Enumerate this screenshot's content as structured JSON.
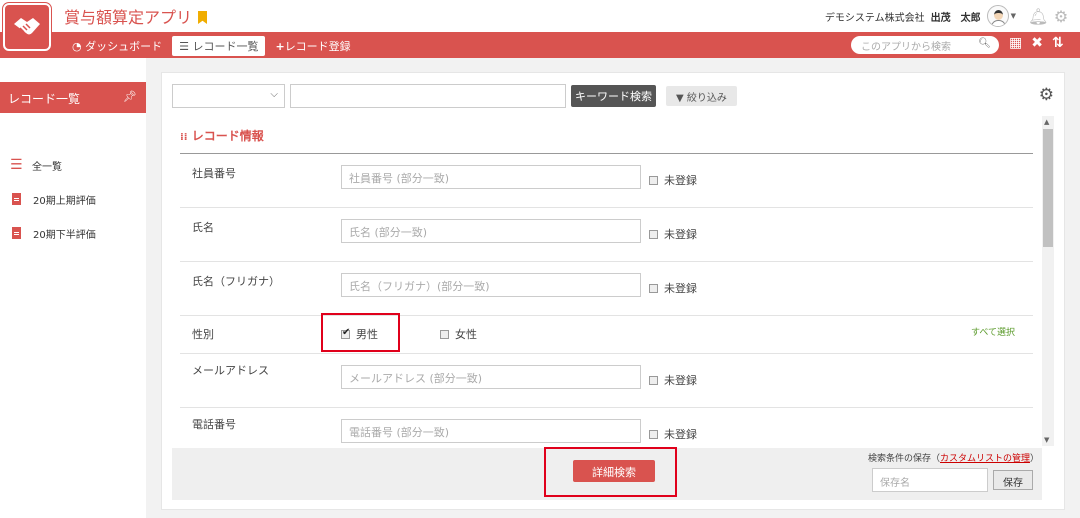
{
  "header": {
    "app_title": "賞与額算定アプリ",
    "company": "デモシステム株式会社",
    "user_name": "出茂　太郎"
  },
  "nav": {
    "items": [
      {
        "label": "ダッシュボード",
        "icon": "dashboard-icon"
      },
      {
        "label": "レコード一覧",
        "icon": "list-icon",
        "active": true
      },
      {
        "label": "レコード登録",
        "icon": "plus-icon"
      }
    ],
    "search_placeholder": "このアプリから検索"
  },
  "sidebar": {
    "title": "レコード一覧",
    "items": [
      {
        "label": "全一覧",
        "icon": "list-icon"
      },
      {
        "label": "20期上期評価",
        "icon": "document-icon"
      },
      {
        "label": "20期下半評価",
        "icon": "document-icon"
      }
    ]
  },
  "toolbar": {
    "select_value": "",
    "keyword_value": "",
    "keyword_button": "キーワード検索",
    "filter_button": "絞り込み"
  },
  "section": {
    "title": "レコード情報",
    "unregistered_label": "未登録",
    "select_all": "すべて選択",
    "fields": [
      {
        "label": "社員番号",
        "placeholder": "社員番号 (部分一致)"
      },
      {
        "label": "氏名",
        "placeholder": "氏名 (部分一致)"
      },
      {
        "label": "氏名（フリガナ）",
        "placeholder": "氏名（フリガナ）(部分一致)"
      }
    ],
    "gender": {
      "label": "性別",
      "options": [
        {
          "label": "男性",
          "checked": true
        },
        {
          "label": "女性",
          "checked": false
        }
      ]
    },
    "fields2": [
      {
        "label": "メールアドレス",
        "placeholder": "メールアドレス (部分一致)"
      },
      {
        "label": "電話番号",
        "placeholder": "電話番号 (部分一致)"
      }
    ]
  },
  "footer": {
    "detail_search": "詳細検索",
    "save_caption_prefix": "検索条件の保存（",
    "save_caption_link": "カスタムリストの管理",
    "save_caption_suffix": "）",
    "save_name_placeholder": "保存名",
    "save_button": "保存"
  },
  "colors": {
    "brand": "#d9534f",
    "highlight": "#e0001b"
  }
}
